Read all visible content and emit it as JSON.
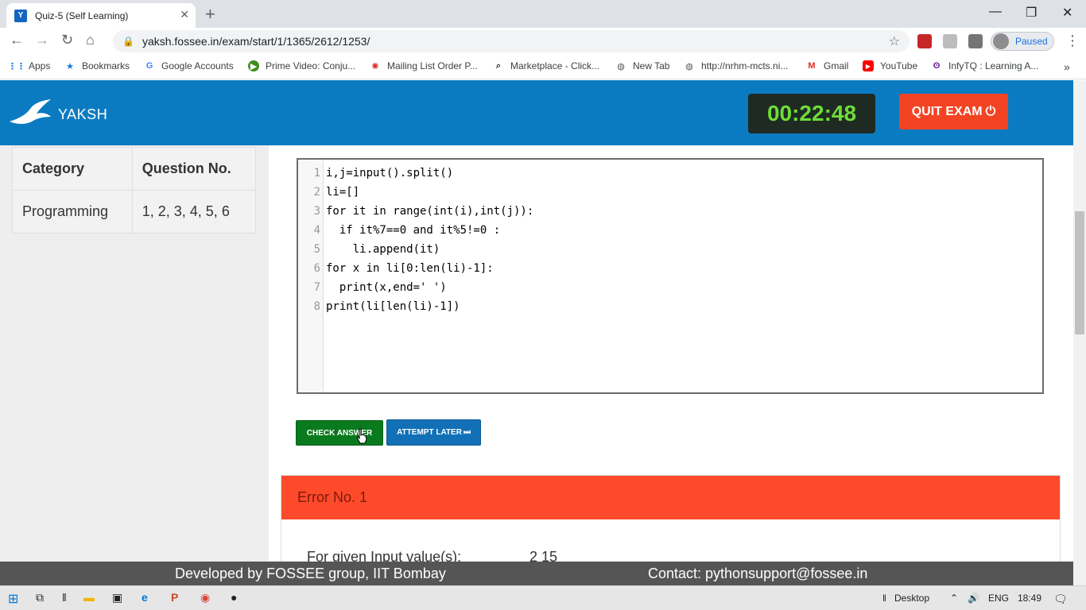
{
  "browser": {
    "tab_title": "Quiz-5 (Self Learning)",
    "favicon_letter": "Y",
    "url": "yaksh.fossee.in/exam/start/1/1365/2612/1253/",
    "profile_label": "Paused",
    "bookmarks": [
      {
        "label": "Apps",
        "icon": "apps-grid-icon"
      },
      {
        "label": "Bookmarks",
        "icon": "star-icon"
      },
      {
        "label": "Google Accounts",
        "icon": "google-icon"
      },
      {
        "label": "Prime Video: Conju...",
        "icon": "play-icon"
      },
      {
        "label": "Mailing List Order P...",
        "icon": "target-icon"
      },
      {
        "label": "Marketplace - Click...",
        "icon": "search-icon"
      },
      {
        "label": "New Tab",
        "icon": "globe-icon"
      },
      {
        "label": "http://nrhm-mcts.ni...",
        "icon": "globe-icon"
      },
      {
        "label": "Gmail",
        "icon": "gmail-icon"
      },
      {
        "label": "YouTube",
        "icon": "youtube-icon"
      },
      {
        "label": "InfyTQ : Learning A...",
        "icon": "infytq-icon"
      }
    ]
  },
  "header": {
    "logo_text": "YAKSH",
    "timer": "00:22:48",
    "quit_label": "QUIT EXAM"
  },
  "sidebar": {
    "col_category": "Category",
    "col_question": "Question No.",
    "row_category": "Programming",
    "row_questions": "1, 2, 3, 4, 5, 6"
  },
  "editor": {
    "lines": [
      "i,j=input().split()",
      "li=[]",
      "for it in range(int(i),int(j)):",
      "  if it%7==0 and it%5!=0 :",
      "    li.append(it)",
      "for x in li[0:len(li)-1]:",
      "  print(x,end=' ')",
      "print(li[len(li)-1])"
    ]
  },
  "actions": {
    "check_label": "CHECK ANSWER",
    "later_label": "ATTEMPT LATER"
  },
  "error": {
    "title": "Error No. 1",
    "input_label": "For given Input value(s):",
    "input_value": "2 15"
  },
  "footer": {
    "developed": "Developed by FOSSEE group, IIT Bombay",
    "contact": "Contact: pythonsupport@fossee.in"
  },
  "taskbar": {
    "desktop_label": "Desktop",
    "lang": "ENG",
    "time": "18:49"
  },
  "colors": {
    "header_blue": "#0b7bc1",
    "timer_green": "#6fdc3a",
    "quit_red": "#f44323",
    "check_green": "#0a7a1e",
    "error_red": "#fd4a2b"
  }
}
